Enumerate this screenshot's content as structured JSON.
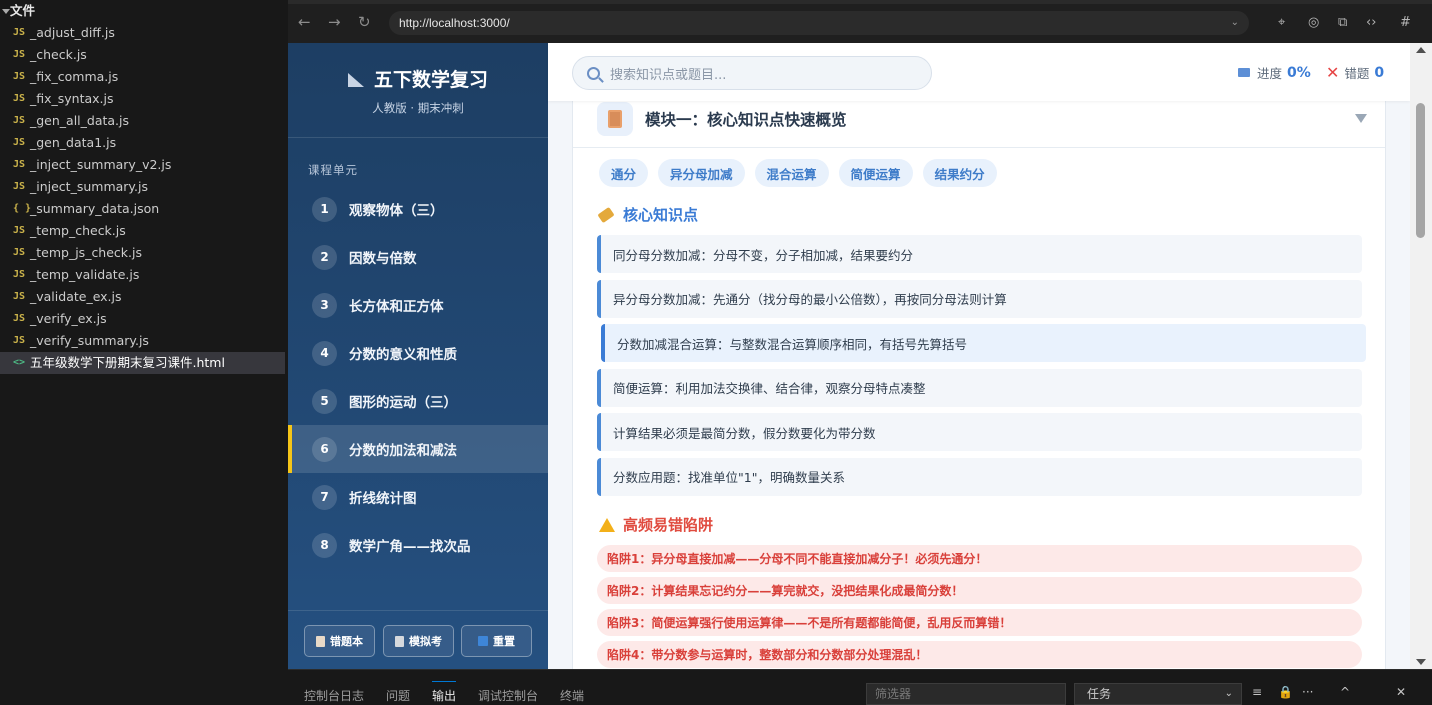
{
  "explorer": {
    "title": "文件",
    "files": [
      {
        "name": "_adjust_diff.js",
        "icon": "JS",
        "type": "js"
      },
      {
        "name": "_check.js",
        "icon": "JS",
        "type": "js"
      },
      {
        "name": "_fix_comma.js",
        "icon": "JS",
        "type": "js"
      },
      {
        "name": "_fix_syntax.js",
        "icon": "JS",
        "type": "js"
      },
      {
        "name": "_gen_all_data.js",
        "icon": "JS",
        "type": "js"
      },
      {
        "name": "_gen_data1.js",
        "icon": "JS",
        "type": "js"
      },
      {
        "name": "_inject_summary_v2.js",
        "icon": "JS",
        "type": "js"
      },
      {
        "name": "_inject_summary.js",
        "icon": "JS",
        "type": "js"
      },
      {
        "name": "_summary_data.json",
        "icon": "{ }",
        "type": "json"
      },
      {
        "name": "_temp_check.js",
        "icon": "JS",
        "type": "js"
      },
      {
        "name": "_temp_js_check.js",
        "icon": "JS",
        "type": "js"
      },
      {
        "name": "_temp_validate.js",
        "icon": "JS",
        "type": "js"
      },
      {
        "name": "_validate_ex.js",
        "icon": "JS",
        "type": "js"
      },
      {
        "name": "_verify_ex.js",
        "icon": "JS",
        "type": "js"
      },
      {
        "name": "_verify_summary.js",
        "icon": "JS",
        "type": "js"
      },
      {
        "name": "五年级数学下册期末复习课件.html",
        "icon": "<>",
        "type": "html"
      }
    ]
  },
  "browser": {
    "url": "http://localhost:3000/",
    "back": "←",
    "forward": "→",
    "reload": "↻",
    "caret": "⌄",
    "tools": [
      "⌖",
      "◎",
      "⧉",
      "‹›",
      "#"
    ]
  },
  "sidebar": {
    "title": "五下数学复习",
    "subtitle": "人教版 · 期末冲刺",
    "section_label": "课程单元",
    "units": [
      {
        "num": "1",
        "label": "观察物体（三）"
      },
      {
        "num": "2",
        "label": "因数与倍数"
      },
      {
        "num": "3",
        "label": "长方体和正方体"
      },
      {
        "num": "4",
        "label": "分数的意义和性质"
      },
      {
        "num": "5",
        "label": "图形的运动（三）"
      },
      {
        "num": "6",
        "label": "分数的加法和减法"
      },
      {
        "num": "7",
        "label": "折线统计图"
      },
      {
        "num": "8",
        "label": "数学广角——找次品"
      }
    ],
    "active_unit": 6,
    "buttons": {
      "wrong_book": "错题本",
      "mock_exam": "模拟考",
      "reset": "重置"
    }
  },
  "topbar": {
    "search_placeholder": "搜索知识点或题目...",
    "progress_label": "进度",
    "progress_value": "0%",
    "wrong_label": "错题",
    "wrong_value": "0"
  },
  "module": {
    "title": "模块一：核心知识点快速概览",
    "tags": [
      "通分",
      "异分母加减",
      "混合运算",
      "简便运算",
      "结果约分"
    ],
    "core_title": "核心知识点",
    "knowledge_points": [
      "同分母分数加减：分母不变，分子相加减，结果要约分",
      "异分母分数加减：先通分（找分母的最小公倍数），再按同分母法则计算",
      "分数加减混合运算：与整数混合运算顺序相同，有括号先算括号",
      "简便运算：利用加法交换律、结合律，观察分母特点凑整",
      "计算结果必须是最简分数，假分数要化为带分数",
      "分数应用题：找准单位\"1\"，明确数量关系"
    ],
    "traps_title": "高频易错陷阱",
    "traps": [
      "陷阱1：异分母直接加减——分母不同不能直接加减分子！必须先通分！",
      "陷阱2：计算结果忘记约分——算完就交，没把结果化成最简分数！",
      "陷阱3：简便运算强行使用运算律——不是所有题都能简便，乱用反而算错！",
      "陷阱4：带分数参与运算时，整数部分和分数部分处理混乱！"
    ]
  },
  "panel": {
    "tabs": [
      "控制台日志",
      "问题",
      "输出",
      "调试控制台",
      "终端"
    ],
    "active_tab": "输出",
    "filter_placeholder": "筛选器",
    "task_select": "任务",
    "task_caret": "⌄",
    "icons": [
      "≡",
      "🔒",
      "···",
      "^",
      "✕"
    ]
  },
  "colors": {
    "sidebar_bg": "#1d3e63",
    "accent": "#3a7bd5",
    "active_marker": "#f5c518",
    "trap_text": "#d9403a"
  }
}
